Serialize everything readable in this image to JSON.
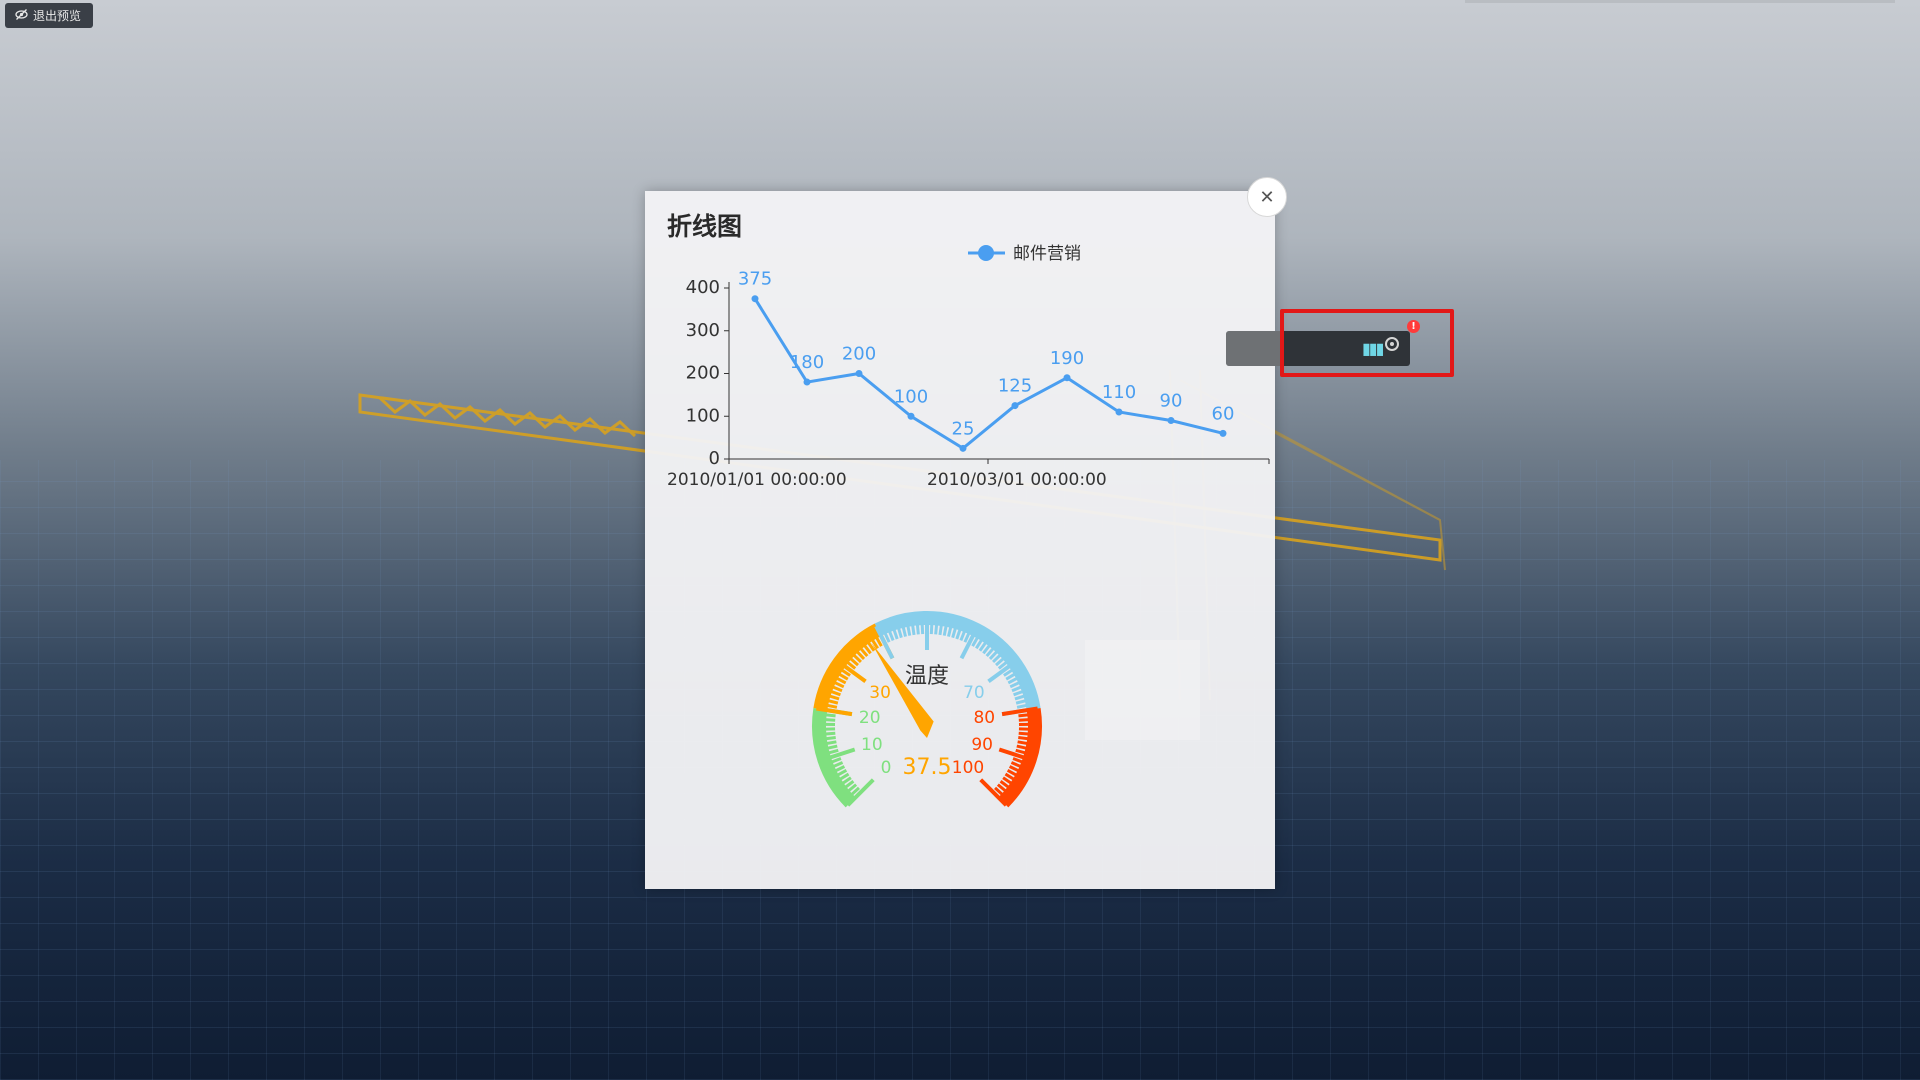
{
  "preview_button": {
    "label": "退出预览",
    "icon": "eye-off-icon"
  },
  "panel": {
    "title": "折线图",
    "close_icon": "close-icon"
  },
  "chart_data": [
    {
      "type": "line",
      "legend": [
        "邮件营销"
      ],
      "x_axis_labels": [
        "2010/01/01 00:00:00",
        "2010/03/01 00:00:00"
      ],
      "y_ticks": [
        0,
        100,
        200,
        300,
        400
      ],
      "ylim": [
        0,
        400
      ],
      "series": [
        {
          "name": "邮件营销",
          "values": [
            375,
            180,
            200,
            100,
            25,
            125,
            190,
            110,
            90,
            60
          ]
        }
      ],
      "colors": {
        "line": "#4a9ef0"
      }
    },
    {
      "type": "gauge",
      "title": "温度",
      "value": 37.5,
      "min": 0,
      "max": 100,
      "tick_labels": [
        "0",
        "10",
        "20",
        "30",
        "70",
        "80",
        "90",
        "100"
      ],
      "colors": {
        "low": "#7fe07f",
        "mid_low": "#ffa500",
        "mid_high": "#87ceeb",
        "high": "#ff4500",
        "pointer": "#ffa500"
      }
    }
  ],
  "toolbar": {
    "bars_icon": "pause-bars-icon",
    "target_icon": "target-icon",
    "warning_icon": "warning-icon",
    "warning_text": "!"
  }
}
